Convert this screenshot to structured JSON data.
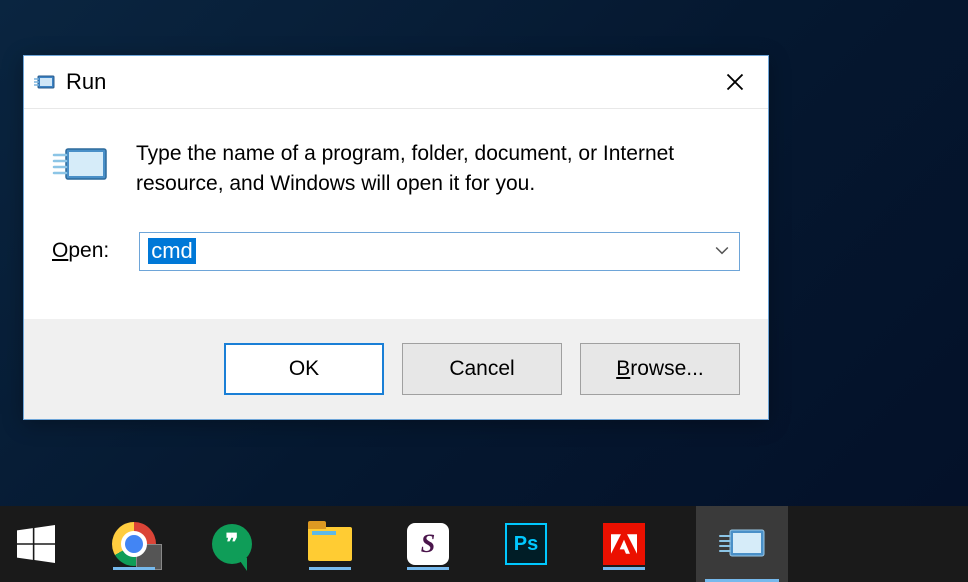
{
  "dialog": {
    "title": "Run",
    "description": "Type the name of a program, folder, document, or Internet resource, and Windows will open it for you.",
    "open_label_pre": "O",
    "open_label_post": "pen:",
    "input_value": "cmd",
    "buttons": {
      "ok": "OK",
      "cancel": "Cancel",
      "browse_pre": "B",
      "browse_post": "rowse..."
    }
  },
  "taskbar": {
    "items": [
      {
        "name": "start",
        "open": false
      },
      {
        "name": "chrome",
        "open": true
      },
      {
        "name": "hangouts",
        "open": false
      },
      {
        "name": "file-explorer",
        "open": true
      },
      {
        "name": "slack",
        "open": true
      },
      {
        "name": "photoshop",
        "open": false
      },
      {
        "name": "adobe",
        "open": true
      },
      {
        "name": "run-dialog",
        "open": true,
        "active": true
      }
    ]
  }
}
